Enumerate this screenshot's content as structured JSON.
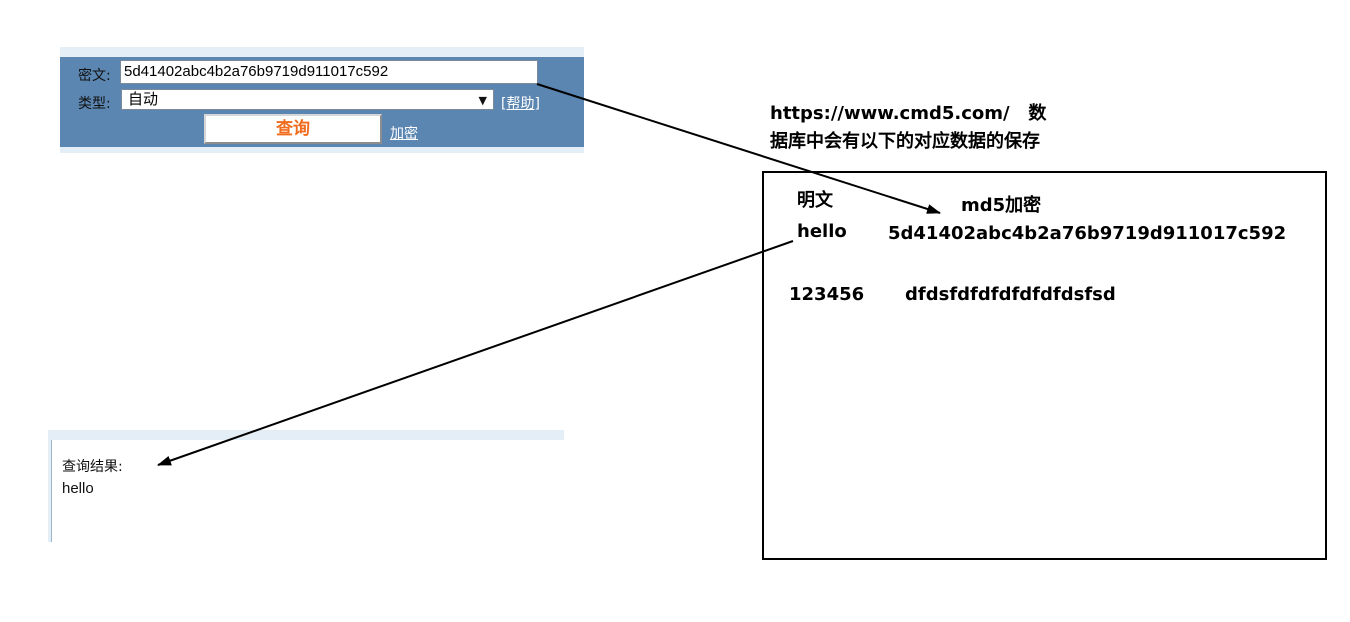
{
  "query_form": {
    "cipher_label": "密文:",
    "cipher_value": "5d41402abc4b2a76b9719d911017c592",
    "type_label": "类型:",
    "type_selected": "自动",
    "help_link": "[帮助]",
    "query_button": "查询",
    "encrypt_link": "加密"
  },
  "annotation": {
    "line1": "https://www.cmd5.com/   数",
    "line2": "据库中会有以下的对应数据的保存"
  },
  "db_table": {
    "header_plain": "明文",
    "header_hash": "md5加密",
    "rows": [
      {
        "plain": "hello",
        "hash": "5d41402abc4b2a76b9719d911017c592"
      },
      {
        "plain": "123456",
        "hash": "dfdsfdfdfdfdfdfdsfsd"
      }
    ]
  },
  "result": {
    "title": "查询结果:",
    "value": "hello"
  },
  "colors": {
    "form_blue": "#5b86b1",
    "panel_light": "#e3eef6",
    "query_orange": "#f06c1f"
  }
}
